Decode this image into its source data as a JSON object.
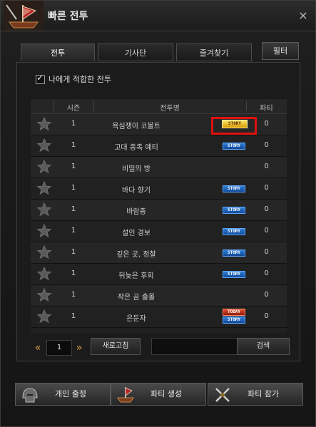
{
  "window": {
    "title": "빠른 전투",
    "close_symbol": "×"
  },
  "tabs": [
    {
      "label": "전투",
      "active": true
    },
    {
      "label": "기사단",
      "active": false
    },
    {
      "label": "즐겨찾기",
      "active": false
    }
  ],
  "filter_label": "필터",
  "suitable_filter": {
    "label": "나에게 적합한 전투",
    "checked": true,
    "check_mark": "✓"
  },
  "table": {
    "headers": {
      "season": "시즌",
      "name": "전투명",
      "party": "파티"
    },
    "rows": [
      {
        "season": "1",
        "name": "욕심쟁이 코볼트",
        "party": "0",
        "badges": [
          "STORY"
        ],
        "badge_style": "gold",
        "highlighted": true
      },
      {
        "season": "1",
        "name": "고대 종족 예티",
        "party": "0",
        "badges": [
          "STORY"
        ]
      },
      {
        "season": "1",
        "name": "비밀의 방",
        "party": "0",
        "badges": []
      },
      {
        "season": "1",
        "name": "바다 향기",
        "party": "0",
        "badges": [
          "STORY"
        ]
      },
      {
        "season": "1",
        "name": "바람총",
        "party": "0",
        "badges": [
          "STORY"
        ]
      },
      {
        "season": "1",
        "name": "설인 경보",
        "party": "0",
        "badges": [
          "STORY"
        ]
      },
      {
        "season": "1",
        "name": "깊은 곳, 정찰",
        "party": "0",
        "badges": [
          "STORY"
        ]
      },
      {
        "season": "1",
        "name": "뒤늦은 후회",
        "party": "0",
        "badges": [
          "STORY"
        ]
      },
      {
        "season": "1",
        "name": "작은 곰 출몰",
        "party": "0",
        "badges": []
      },
      {
        "season": "1",
        "name": "은둔자",
        "party": "0",
        "badges": [
          "TODAY",
          "STORY"
        ]
      }
    ]
  },
  "pagination": {
    "prev_symbol": "«",
    "page": "1",
    "next_symbol": "»"
  },
  "refresh_label": "새로고침",
  "search": {
    "value": "",
    "placeholder": "",
    "button_label": "검색"
  },
  "bottom_buttons": {
    "solo": "개인 출정",
    "create_party": "파티 생성",
    "join_party": "파티 참가"
  },
  "colors": {
    "accent_gold": "#d4a24a",
    "story_badge": "#2e7fd8",
    "today_badge": "#e04a2a",
    "highlight_box": "#e01010"
  }
}
